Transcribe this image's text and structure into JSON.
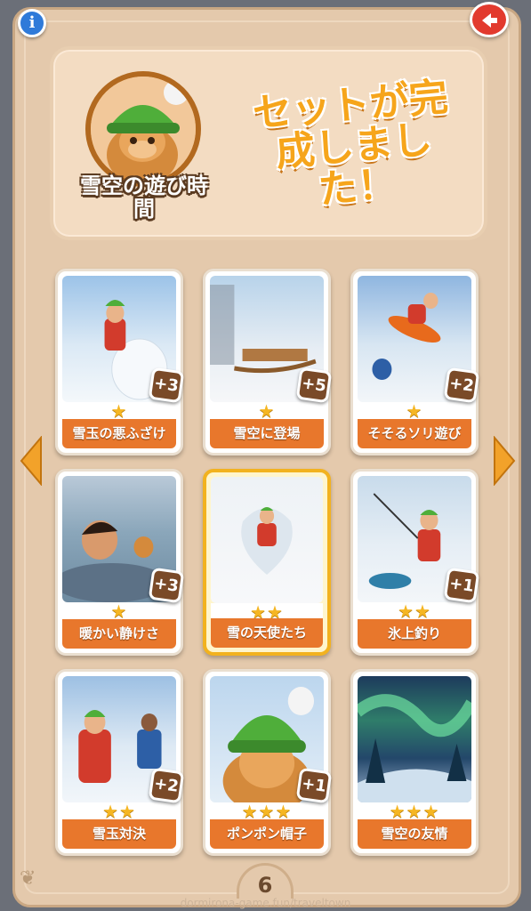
{
  "header": {
    "info_icon": "info-icon",
    "back_icon": "back-arrow-icon"
  },
  "banner": {
    "set_name": "雪空の遊び時間",
    "completed_line1": "セットが完",
    "completed_line2": "成しまし",
    "completed_line3": "た！"
  },
  "navigation": {
    "prev_icon": "chevron-left-icon",
    "next_icon": "chevron-right-icon",
    "page_number": "6"
  },
  "cards": [
    {
      "title": "雪玉の悪ふざけ",
      "stars": "★",
      "count": "+3",
      "art": "snowball"
    },
    {
      "title": "雪空に登場",
      "stars": "★",
      "count": "+5",
      "art": "sled"
    },
    {
      "title": "そそるソリ遊び",
      "stars": "★",
      "count": "+2",
      "art": "sledding"
    },
    {
      "title": "暖かい静けさ",
      "stars": "★",
      "count": "+3",
      "art": "hotspring"
    },
    {
      "title": "雪の天使たち",
      "stars": "★★",
      "count": "",
      "art": "angel"
    },
    {
      "title": "氷上釣り",
      "stars": "★★",
      "count": "+1",
      "art": "fishing"
    },
    {
      "title": "雪玉対決",
      "stars": "★★",
      "count": "+2",
      "art": "fight"
    },
    {
      "title": "ポンポン帽子",
      "stars": "★★★",
      "count": "+1",
      "art": "hat"
    },
    {
      "title": "雪空の友情",
      "stars": "★★★",
      "count": "",
      "art": "aurora"
    }
  ],
  "watermark": "dormirona-game.fun/traveltown"
}
